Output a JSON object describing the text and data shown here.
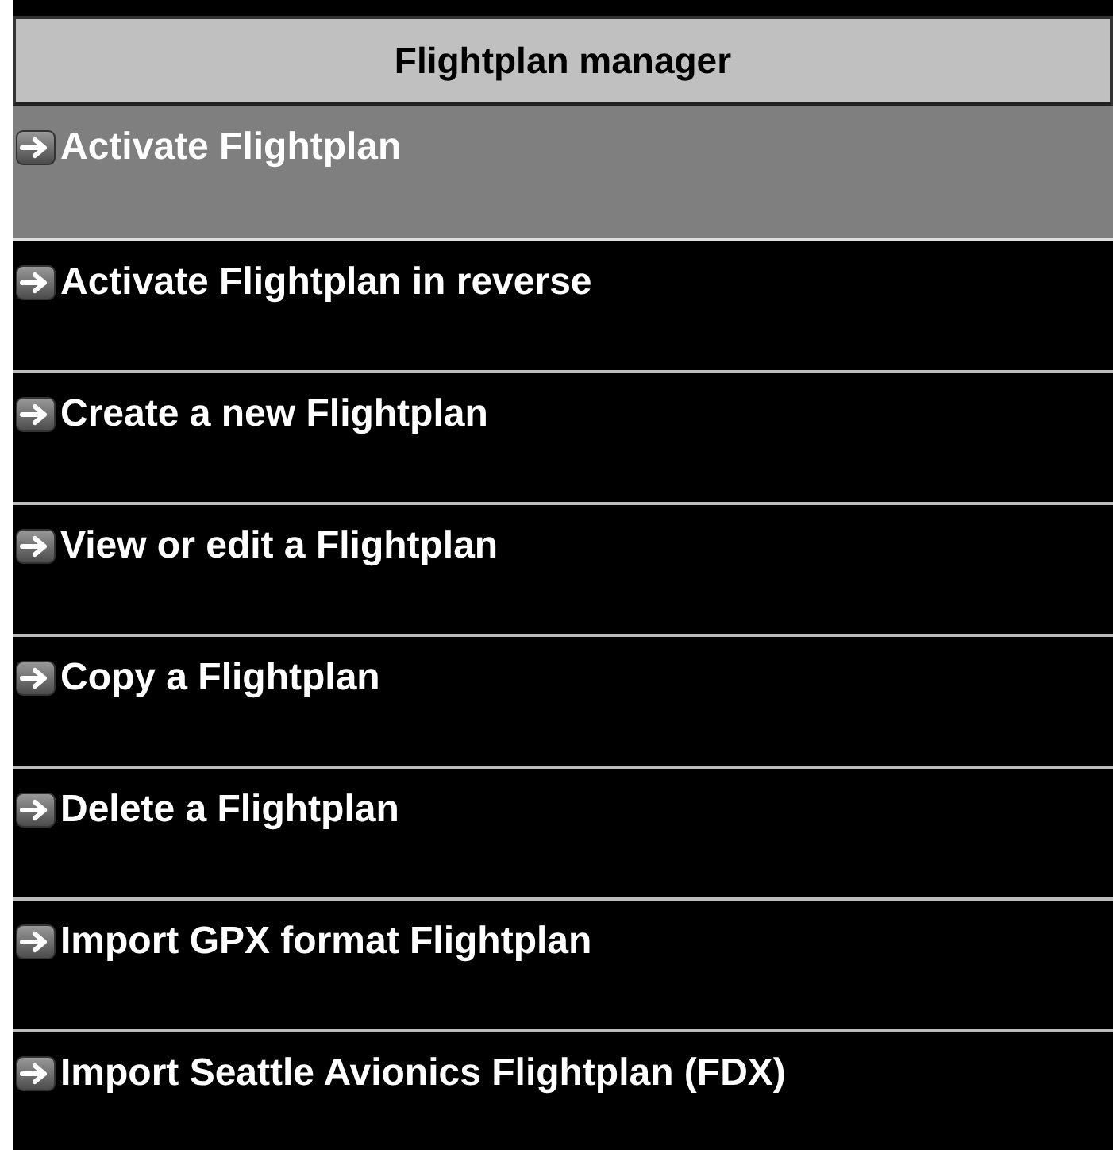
{
  "title": "Flightplan manager",
  "items": [
    {
      "label": "Activate Flightplan",
      "selected": true
    },
    {
      "label": "Activate Flightplan in reverse",
      "selected": false
    },
    {
      "label": "Create a new Flightplan",
      "selected": false
    },
    {
      "label": "View or edit a Flightplan",
      "selected": false
    },
    {
      "label": "Copy a Flightplan",
      "selected": false
    },
    {
      "label": "Delete a Flightplan",
      "selected": false
    },
    {
      "label": "Import GPX format Flightplan",
      "selected": false
    },
    {
      "label": "Import Seattle Avionics Flightplan (FDX)",
      "selected": false
    }
  ]
}
